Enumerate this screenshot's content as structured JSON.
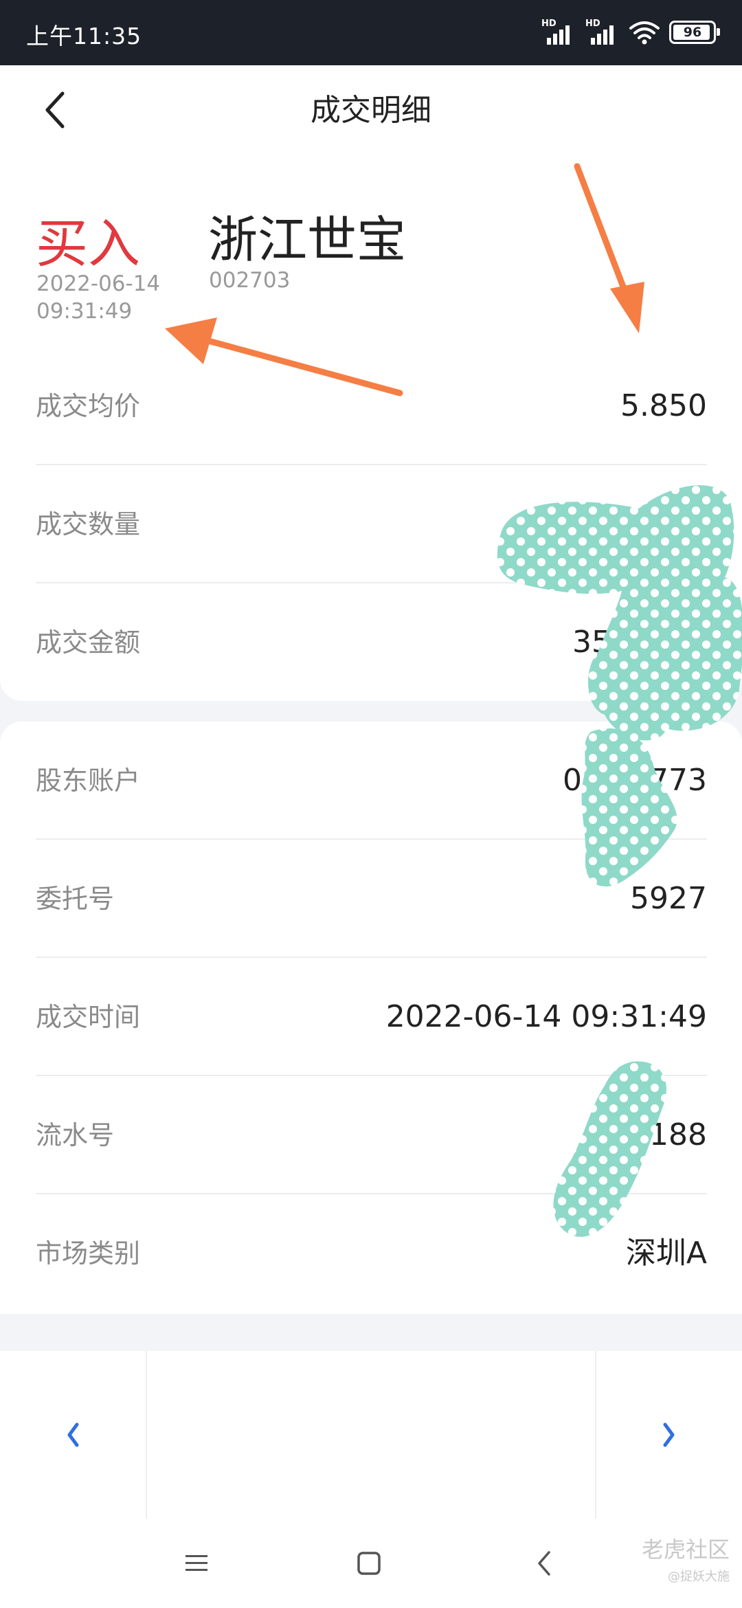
{
  "status_bar": {
    "time": "上午11:35",
    "network_labels": [
      "HD",
      "HD"
    ],
    "battery": "96"
  },
  "header": {
    "title": "成交明细"
  },
  "trade": {
    "side": "买入",
    "time": "2022-06-14\n09:31:49",
    "stock_name": "浙江世宝",
    "stock_code": "002703"
  },
  "details_top": [
    {
      "label": "成交均价",
      "value": "5.850"
    },
    {
      "label": "成交数量",
      "value": ""
    },
    {
      "label": "成交金额",
      "value": "35"
    }
  ],
  "details_bottom": [
    {
      "label": "股东账户",
      "value": "0137 773"
    },
    {
      "label": "委托号",
      "value": "5927"
    },
    {
      "label": "成交时间",
      "value": "2022-06-14 09:31:49"
    },
    {
      "label": "流水号",
      "value": "80 188"
    },
    {
      "label": "市场类别",
      "value": "深圳A"
    }
  ],
  "watermark": {
    "line1": "老虎社区",
    "line2": "@捉妖大施"
  },
  "colors": {
    "buy_red": "#e0393e",
    "accent_blue": "#2f6fe0",
    "arrow_orange": "#f57e45",
    "redaction_teal": "#8fd9c9",
    "status_bar": "#1d212a"
  },
  "icons": [
    "back-arrow-icon",
    "prev-chevron-icon",
    "next-chevron-icon",
    "menu-icon",
    "home-icon",
    "back-icon",
    "wifi-icon",
    "signal-icon",
    "battery-icon"
  ]
}
